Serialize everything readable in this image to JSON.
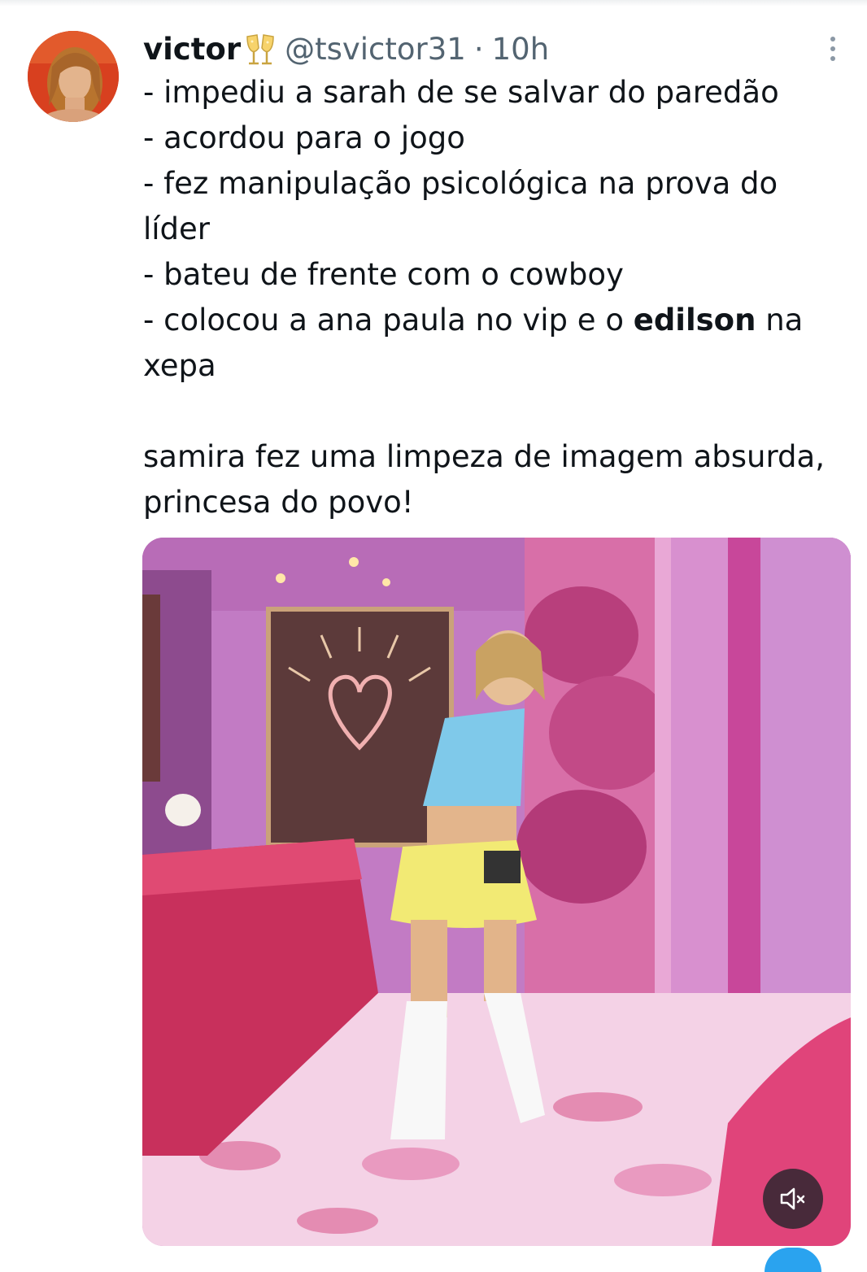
{
  "author": {
    "display_name": "victor",
    "name_emoji": "clinking-glasses-icon",
    "handle": "@tsvictor31",
    "separator": "·",
    "time": "10h"
  },
  "tweet": {
    "lines": [
      "- impediu a sarah de se salvar do paredão",
      "- acordou para o jogo",
      "- fez manipulação psicológica na prova do",
      "líder",
      "- bateu de frente com o cowboy"
    ],
    "line6_before": "- colocou a ana paula no vip e o ",
    "line6_bold": "edilson",
    "line6_after": " na",
    "line7": "xepa",
    "line8": "samira fez uma limpeza de imagem absurda,",
    "line9": "princesa do povo!"
  },
  "media": {
    "type": "video",
    "muted": true,
    "mute_icon": "speaker-muted-icon"
  },
  "colors": {
    "text": "#0f1419",
    "secondary": "#536471",
    "accent": "#2aa3ef"
  }
}
